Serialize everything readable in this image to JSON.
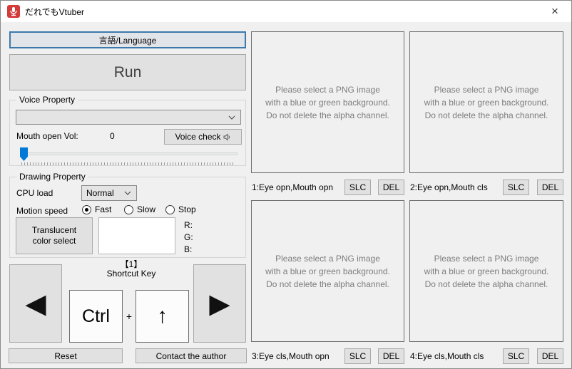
{
  "colors": {
    "accent_focus_blue": "#3b79ab",
    "slider_thumb_blue": "#0078d7",
    "app_icon_red": "#d43b3b",
    "placeholder_gray": "#7d7d7d",
    "window_bg": "#f0f0f0",
    "button_bg": "#e1e1e1"
  },
  "window": {
    "title": "だれでもVtuber",
    "close_icon": "×"
  },
  "left": {
    "language_button": "言語/Language",
    "run_button": "Run",
    "voice": {
      "legend": "Voice Property",
      "combo_value": "",
      "mouth_label": "Mouth open Vol:",
      "mouth_value": "0",
      "check_button": "Voice check",
      "slider_value": 0
    },
    "drawing": {
      "legend": "Drawing Property",
      "cpu_label": "CPU load",
      "cpu_value": "Normal",
      "motion_label": "Motion speed",
      "radios": [
        {
          "label": "Fast",
          "selected": true
        },
        {
          "label": "Slow",
          "selected": false
        },
        {
          "label": "Stop",
          "selected": false
        }
      ],
      "translucent_button": "Translucent color select",
      "rgb_labels": [
        "R:",
        "G:",
        "B:"
      ]
    },
    "shortcut": {
      "index": "【1】",
      "title": "Shortcut Key",
      "prev_icon": "◀",
      "key_main": "Ctrl",
      "plus": "+",
      "key_secondary": "↑",
      "next_icon": "▶"
    },
    "reset_button": "Reset",
    "contact_button": "Contact the author"
  },
  "placeholder": [
    "Please select a PNG image",
    "with a blue or green background.",
    "Do not delete the alpha channel."
  ],
  "slots": [
    {
      "label": "1:Eye opn,Mouth opn",
      "slc": "SLC",
      "del": "DEL"
    },
    {
      "label": "2:Eye opn,Mouth cls",
      "slc": "SLC",
      "del": "DEL"
    },
    {
      "label": "3:Eye cls,Mouth opn",
      "slc": "SLC",
      "del": "DEL"
    },
    {
      "label": "4:Eye cls,Mouth cls",
      "slc": "SLC",
      "del": "DEL"
    }
  ]
}
